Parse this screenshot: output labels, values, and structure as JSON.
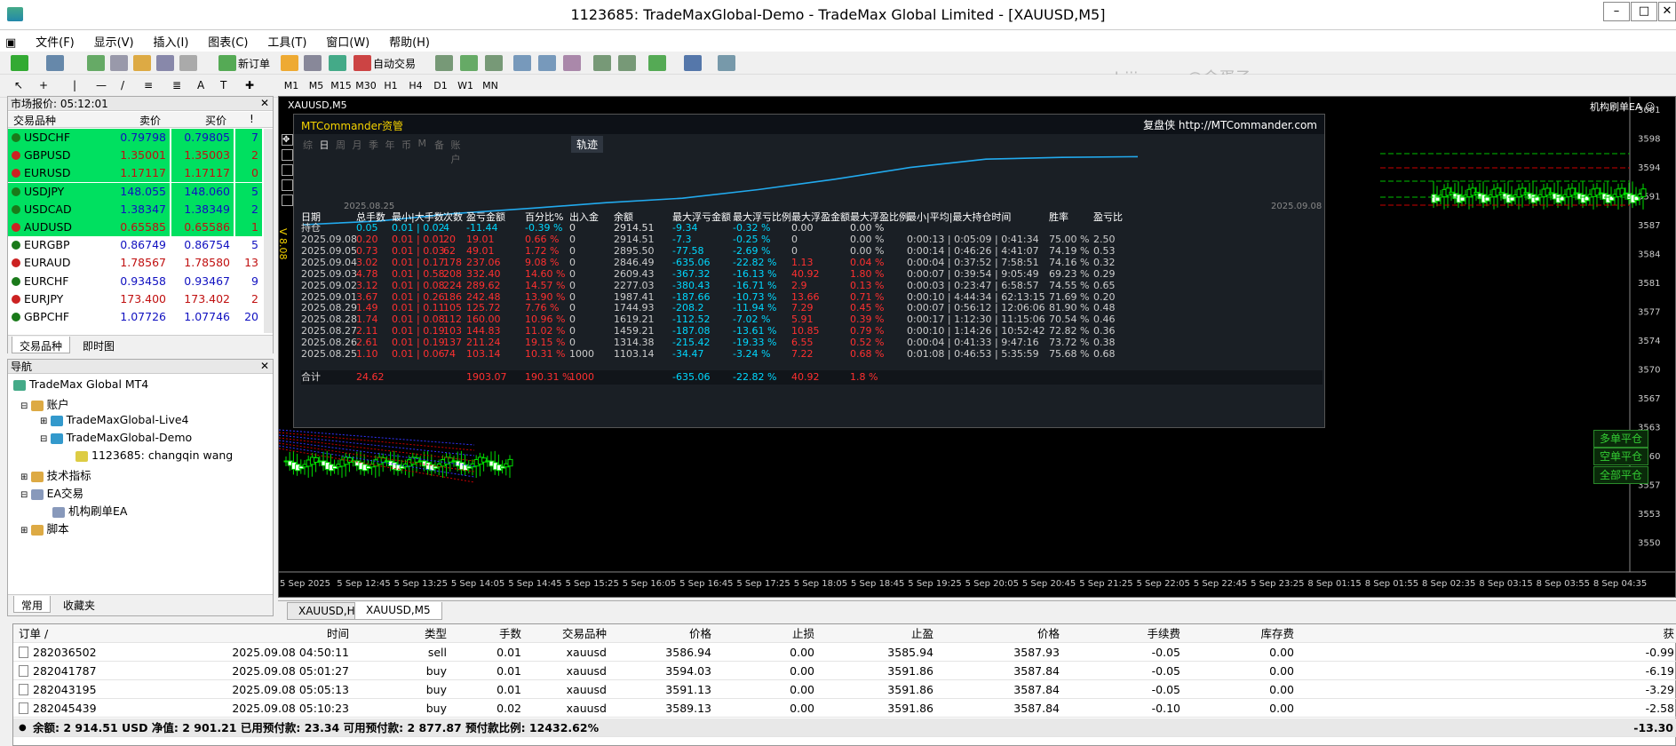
{
  "window": {
    "title": "1123685: TradeMaxGlobal-Demo - TradeMax Global Limited - [XAUUSD,M5]"
  },
  "menu": [
    "文件(F)",
    "显示(V)",
    "插入(I)",
    "图表(C)",
    "工具(T)",
    "窗口(W)",
    "帮助(H)"
  ],
  "toolbar": {
    "new_order": "新订单",
    "auto_trade": "自动交易",
    "timeframes": [
      "M1",
      "M5",
      "M15",
      "M30",
      "H1",
      "H4",
      "D1",
      "W1",
      "MN"
    ]
  },
  "watermark": "www.eazhijia.com@金蛋子",
  "market_watch": {
    "title": "市场报价: 05:12:01",
    "headers": [
      "交易品种",
      "卖价",
      "买价",
      "!"
    ],
    "rows": [
      {
        "sym": "USDCHF",
        "bid": "0.79798",
        "ask": "0.79805",
        "spr": "7",
        "bg": "#00e060",
        "dir": "up"
      },
      {
        "sym": "GBPUSD",
        "bid": "1.35001",
        "ask": "1.35003",
        "spr": "2",
        "bg": "#00e060",
        "dir": "down"
      },
      {
        "sym": "EURUSD",
        "bid": "1.17117",
        "ask": "1.17117",
        "spr": "0",
        "bg": "#00e060",
        "dir": "down"
      },
      {
        "sym": "USDJPY",
        "bid": "148.055",
        "ask": "148.060",
        "spr": "5",
        "bg": "#00e060",
        "dir": "up"
      },
      {
        "sym": "USDCAD",
        "bid": "1.38347",
        "ask": "1.38349",
        "spr": "2",
        "bg": "#00e060",
        "dir": "up"
      },
      {
        "sym": "AUDUSD",
        "bid": "0.65585",
        "ask": "0.65586",
        "spr": "1",
        "bg": "#00e060",
        "dir": "down"
      },
      {
        "sym": "EURGBP",
        "bid": "0.86749",
        "ask": "0.86754",
        "spr": "5",
        "bg": "#ffffff",
        "dir": "up"
      },
      {
        "sym": "EURAUD",
        "bid": "1.78567",
        "ask": "1.78580",
        "spr": "13",
        "bg": "#ffffff",
        "dir": "down"
      },
      {
        "sym": "EURCHF",
        "bid": "0.93458",
        "ask": "0.93467",
        "spr": "9",
        "bg": "#ffffff",
        "dir": "up"
      },
      {
        "sym": "EURJPY",
        "bid": "173.400",
        "ask": "173.402",
        "spr": "2",
        "bg": "#ffffff",
        "dir": "down"
      },
      {
        "sym": "GBPCHF",
        "bid": "1.07726",
        "ask": "1.07746",
        "spr": "20",
        "bg": "#ffffff",
        "dir": "up"
      }
    ],
    "tabs": [
      "交易品种",
      "即时图"
    ]
  },
  "navigator": {
    "title": "导航",
    "items": [
      "TradeMax Global MT4",
      "账户",
      "TradeMaxGlobal-Live4",
      "TradeMaxGlobal-Demo",
      "1123685: changqin wang",
      "技术指标",
      "EA交易",
      "机构刷单EA",
      "脚本"
    ],
    "tabs": [
      "常用",
      "收藏夹"
    ]
  },
  "chart": {
    "symbol_label": "XAUUSD,M5",
    "ea_label": "机构刷单EA ☺",
    "side_text": "V 8.08",
    "price_ticks": [
      "3601",
      "3598",
      "3594",
      "3591",
      "3587",
      "3584",
      "3581",
      "3577",
      "3574",
      "3570",
      "3567",
      "3563",
      "3560",
      "3557",
      "3553",
      "3550"
    ],
    "time_ticks": [
      "5 Sep 2025",
      "5 Sep 12:45",
      "5 Sep 13:25",
      "5 Sep 14:05",
      "5 Sep 14:45",
      "5 Sep 15:25",
      "5 Sep 16:05",
      "5 Sep 16:45",
      "5 Sep 17:25",
      "5 Sep 18:05",
      "5 Sep 18:45",
      "5 Sep 19:25",
      "5 Sep 20:05",
      "5 Sep 20:45",
      "5 Sep 21:25",
      "5 Sep 22:05",
      "5 Sep 22:45",
      "5 Sep 23:25",
      "8 Sep 01:15",
      "8 Sep 01:55",
      "8 Sep 02:35",
      "8 Sep 03:15",
      "8 Sep 03:55",
      "8 Sep 04:35"
    ],
    "close_buttons": [
      "多单平仓",
      "空单平仓",
      "全部平仓"
    ],
    "tabs": [
      "XAUUSD,H1",
      "XAUUSD,M5"
    ]
  },
  "mtc": {
    "title": "MTCommander资管",
    "link": "复盘侠 http://MTCommander.com",
    "tabs": [
      "综",
      "日",
      "周",
      "月",
      "季",
      "年",
      "币",
      "M",
      "备",
      "账户"
    ],
    "track_label": "轨迹",
    "date_start": "2025.08.25",
    "date_end": "2025.09.08",
    "columns": [
      "日期",
      "总手数",
      "最小|大手数",
      "次数",
      "盈亏金额",
      "百分比%",
      "出入金",
      "余额",
      "最大浮亏金额",
      "最大浮亏比例",
      "最大浮盈金额",
      "最大浮盈比例",
      "最小|平均|最大持仓时间",
      "胜率",
      "盈亏比"
    ],
    "holding": {
      "label": "持仓",
      "lots": "0.05",
      "minmax": "0.01 | 0.02",
      "count": "4",
      "pl": "-11.44",
      "pct": "-0.39 %",
      "io": "0",
      "bal": "2914.51",
      "mfl": "-9.34",
      "mflp": "-0.32 %",
      "mfp": "0.00",
      "mfpp": "0.00 %",
      "time": "",
      "win": "",
      "rr": ""
    },
    "rows": [
      {
        "date": "2025.09.08",
        "lots": "0.20",
        "minmax": "0.01 | 0.01",
        "count": "20",
        "pl": "19.01",
        "pct": "0.66 %",
        "io": "0",
        "bal": "2914.51",
        "mfl": "-7.3",
        "mflp": "-0.25 %",
        "mfp": "0",
        "mfpp": "0.00 %",
        "time": "0:00:13 | 0:05:09 | 0:41:34",
        "win": "75.00 %",
        "rr": "2.50"
      },
      {
        "date": "2025.09.05",
        "lots": "0.73",
        "minmax": "0.01 | 0.03",
        "count": "62",
        "pl": "49.01",
        "pct": "1.72 %",
        "io": "0",
        "bal": "2895.50",
        "mfl": "-77.58",
        "mflp": "-2.69 %",
        "mfp": "0",
        "mfpp": "0.00 %",
        "time": "0:00:14 | 0:46:26 | 4:41:07",
        "win": "74.19 %",
        "rr": "0.53"
      },
      {
        "date": "2025.09.04",
        "lots": "3.02",
        "minmax": "0.01 | 0.17",
        "count": "178",
        "pl": "237.06",
        "pct": "9.08 %",
        "io": "0",
        "bal": "2846.49",
        "mfl": "-635.06",
        "mflp": "-22.82 %",
        "mfp": "1.13",
        "mfpp": "0.04 %",
        "time": "0:00:04 | 0:37:52 | 7:58:51",
        "win": "74.16 %",
        "rr": "0.32"
      },
      {
        "date": "2025.09.03",
        "lots": "4.78",
        "minmax": "0.01 | 0.58",
        "count": "208",
        "pl": "332.40",
        "pct": "14.60 %",
        "io": "0",
        "bal": "2609.43",
        "mfl": "-367.32",
        "mflp": "-16.13 %",
        "mfp": "40.92",
        "mfpp": "1.80 %",
        "time": "0:00:07 | 0:39:54 | 9:05:49",
        "win": "69.23 %",
        "rr": "0.29"
      },
      {
        "date": "2025.09.02",
        "lots": "3.12",
        "minmax": "0.01 | 0.08",
        "count": "224",
        "pl": "289.62",
        "pct": "14.57 %",
        "io": "0",
        "bal": "2277.03",
        "mfl": "-380.43",
        "mflp": "-16.71 %",
        "mfp": "2.9",
        "mfpp": "0.13 %",
        "time": "0:00:03 | 0:23:47 | 6:58:57",
        "win": "74.55 %",
        "rr": "0.65"
      },
      {
        "date": "2025.09.01",
        "lots": "3.67",
        "minmax": "0.01 | 0.26",
        "count": "186",
        "pl": "242.48",
        "pct": "13.90 %",
        "io": "0",
        "bal": "1987.41",
        "mfl": "-187.66",
        "mflp": "-10.73 %",
        "mfp": "13.66",
        "mfpp": "0.71 %",
        "time": "0:00:10 | 4:44:34 | 62:13:15",
        "win": "71.69 %",
        "rr": "0.20"
      },
      {
        "date": "2025.08.29",
        "lots": "1.49",
        "minmax": "0.01 | 0.11",
        "count": "105",
        "pl": "125.72",
        "pct": "7.76 %",
        "io": "0",
        "bal": "1744.93",
        "mfl": "-208.2",
        "mflp": "-11.94 %",
        "mfp": "7.29",
        "mfpp": "0.45 %",
        "time": "0:00:07 | 0:56:12 | 12:06:06",
        "win": "81.90 %",
        "rr": "0.48"
      },
      {
        "date": "2025.08.28",
        "lots": "1.74",
        "minmax": "0.01 | 0.08",
        "count": "112",
        "pl": "160.00",
        "pct": "10.96 %",
        "io": "0",
        "bal": "1619.21",
        "mfl": "-112.52",
        "mflp": "-7.02 %",
        "mfp": "5.91",
        "mfpp": "0.39 %",
        "time": "0:00:17 | 1:12:30 | 11:15:06",
        "win": "70.54 %",
        "rr": "0.46"
      },
      {
        "date": "2025.08.27",
        "lots": "2.11",
        "minmax": "0.01 | 0.19",
        "count": "103",
        "pl": "144.83",
        "pct": "11.02 %",
        "io": "0",
        "bal": "1459.21",
        "mfl": "-187.08",
        "mflp": "-13.61 %",
        "mfp": "10.85",
        "mfpp": "0.79 %",
        "time": "0:00:10 | 1:14:26 | 10:52:42",
        "win": "72.82 %",
        "rr": "0.36"
      },
      {
        "date": "2025.08.26",
        "lots": "2.61",
        "minmax": "0.01 | 0.19",
        "count": "137",
        "pl": "211.24",
        "pct": "19.15 %",
        "io": "0",
        "bal": "1314.38",
        "mfl": "-215.42",
        "mflp": "-19.33 %",
        "mfp": "6.55",
        "mfpp": "0.52 %",
        "time": "0:00:04 | 0:41:33 | 9:47:16",
        "win": "73.72 %",
        "rr": "0.38"
      },
      {
        "date": "2025.08.25",
        "lots": "1.10",
        "minmax": "0.01 | 0.06",
        "count": "74",
        "pl": "103.14",
        "pct": "10.31 %",
        "io": "1000",
        "bal": "1103.14",
        "mfl": "-34.47",
        "mflp": "-3.24 %",
        "mfp": "7.22",
        "mfpp": "0.68 %",
        "time": "0:01:08 | 0:46:53 | 5:35:59",
        "win": "75.68 %",
        "rr": "0.68"
      }
    ],
    "total": {
      "label": "合计",
      "lots": "24.62",
      "pl": "1903.07",
      "pct": "190.31 %",
      "io": "1000",
      "mfl": "-635.06",
      "mflp": "-22.82 %",
      "mfp": "40.92",
      "mfpp": "1.8 %"
    },
    "balance_curve": [
      1000,
      1103,
      1314,
      1459,
      1619,
      1745,
      1987,
      2277,
      2609,
      2846,
      2896,
      2914
    ]
  },
  "terminal": {
    "columns": [
      "订单 /",
      "时间",
      "类型",
      "手数",
      "交易品种",
      "价格",
      "止损",
      "止盈",
      "价格",
      "手续费",
      "库存费",
      "获"
    ],
    "orders": [
      {
        "id": "282036502",
        "time": "2025.09.08 04:50:11",
        "type": "sell",
        "lots": "0.01",
        "sym": "xauusd",
        "price": "3586.94",
        "sl": "0.00",
        "tp": "3585.94",
        "cur": "3587.93",
        "comm": "-0.05",
        "swap": "0.00",
        "profit": "-0.99"
      },
      {
        "id": "282041787",
        "time": "2025.09.08 05:01:27",
        "type": "buy",
        "lots": "0.01",
        "sym": "xauusd",
        "price": "3594.03",
        "sl": "0.00",
        "tp": "3591.86",
        "cur": "3587.84",
        "comm": "-0.05",
        "swap": "0.00",
        "profit": "-6.19"
      },
      {
        "id": "282043195",
        "time": "2025.09.08 05:05:13",
        "type": "buy",
        "lots": "0.01",
        "sym": "xauusd",
        "price": "3591.13",
        "sl": "0.00",
        "tp": "3591.86",
        "cur": "3587.84",
        "comm": "-0.05",
        "swap": "0.00",
        "profit": "-3.29"
      },
      {
        "id": "282045439",
        "time": "2025.09.08 05:10:23",
        "type": "buy",
        "lots": "0.02",
        "sym": "xauusd",
        "price": "3589.13",
        "sl": "0.00",
        "tp": "3591.86",
        "cur": "3587.84",
        "comm": "-0.10",
        "swap": "0.00",
        "profit": "-2.58"
      }
    ],
    "summary": "余额: 2 914.51 USD  净值: 2 901.21  已用预付款: 23.34  可用预付款: 2 877.87  预付款比例: 12432.62%",
    "summary_total": "-13.30"
  },
  "colors": {
    "up": "#1a7a1a",
    "down": "#cc2222",
    "mtc_red": "#ff3030",
    "mtc_cyan": "#00d8ff",
    "curve": "#22aaee"
  }
}
